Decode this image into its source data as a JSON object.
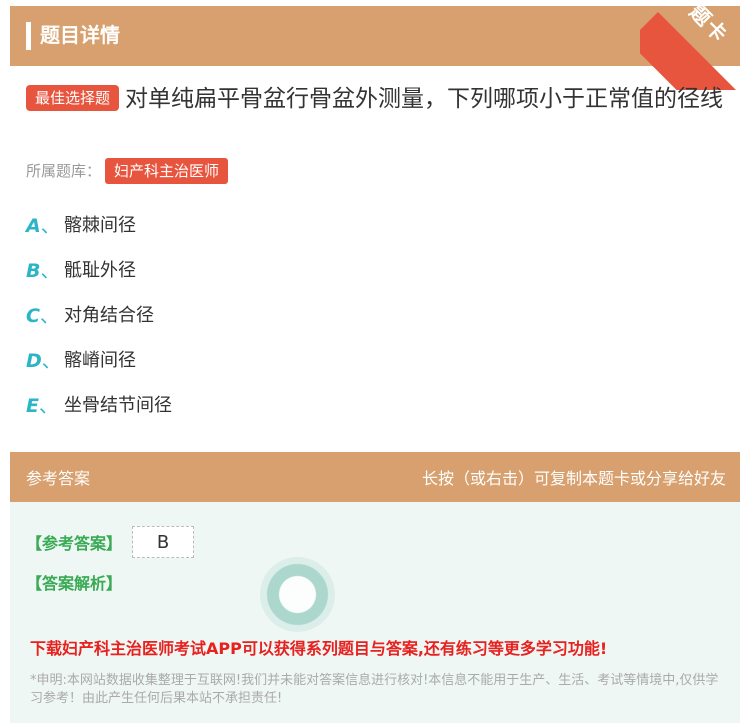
{
  "header": {
    "title": "题目详情",
    "ribbon_text": "题卡"
  },
  "question": {
    "tag": "最佳选择题",
    "text": "对单纯扁平骨盆行骨盆外测量，下列哪项小于正常值的径线"
  },
  "bank": {
    "label": "所属题库：",
    "name": "妇产科主治医师"
  },
  "options": [
    {
      "key": "A",
      "sep": "、",
      "text": "髂棘间径"
    },
    {
      "key": "B",
      "sep": "、",
      "text": "骶耻外径"
    },
    {
      "key": "C",
      "sep": "、",
      "text": "对角结合径"
    },
    {
      "key": "D",
      "sep": "、",
      "text": "髂嵴间径"
    },
    {
      "key": "E",
      "sep": "、",
      "text": "坐骨结节间径"
    }
  ],
  "answer_section": {
    "title": "参考答案",
    "hint": "长按（或右击）可复制本题卡或分享给好友",
    "ref_label": "【参考答案】",
    "ref_value": "B",
    "analysis_label": "【答案解析】",
    "promo": "下载妇产科主治医师考试APP可以获得系列题目与答案,还有练习等更多学习功能!",
    "disclaimer": "*申明:本网站数据收集整理于互联网!我们并未能对答案信息进行核对!本信息不能用于生产、生活、考试等情境中,仅供学习参考！由此产生任何后果本站不承担责任!"
  }
}
